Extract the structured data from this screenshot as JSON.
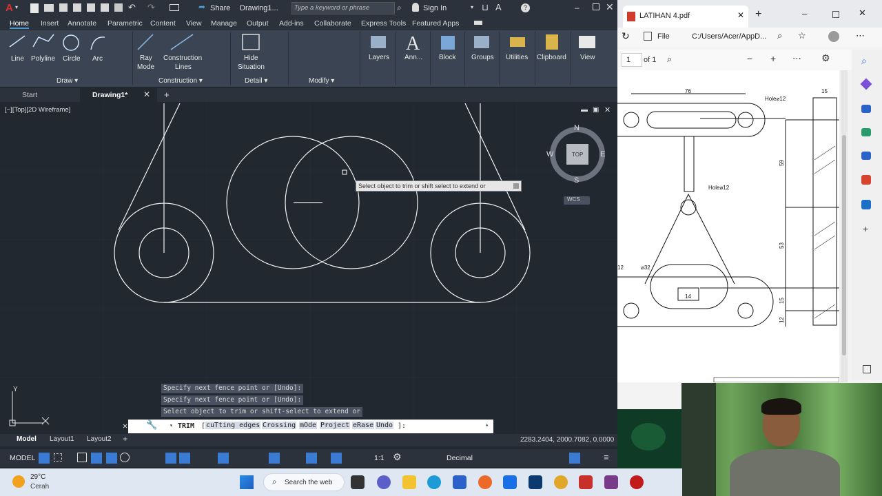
{
  "acad": {
    "app_logo": "A",
    "share_label": "Share",
    "doc_title": "Drawing1...",
    "search_placeholder": "Type a keyword or phrase",
    "signin_label": "Sign In",
    "ribbon_tabs": [
      "Home",
      "Insert",
      "Annotate",
      "Parametric",
      "Content",
      "View",
      "Manage",
      "Output",
      "Add-ins",
      "Collaborate",
      "Express Tools",
      "Featured Apps"
    ],
    "draw_tools": [
      "Line",
      "Polyline",
      "Circle",
      "Arc"
    ],
    "ray_label": "Ray\nMode",
    "ray_line1": "Ray",
    "ray_line2": "Mode",
    "construction_line1": "Construction",
    "construction_line2": "Lines",
    "hide_line1": "Hide",
    "hide_line2": "Situation",
    "big_tools": [
      "Layers",
      "Ann...",
      "Block",
      "Groups",
      "Utilities",
      "Clipboard",
      "View"
    ],
    "panel_titles": {
      "draw": "Draw ▾",
      "construction": "Construction ▾",
      "detail": "Detail ▾",
      "modify": "Modify ▾"
    },
    "doc_tabs": {
      "start": "Start",
      "drawing": "Drawing1*"
    },
    "viewport_label": "[−][Top][2D Wireframe]",
    "viewcube": {
      "n": "N",
      "s": "S",
      "e": "E",
      "w": "W",
      "top": "TOP",
      "wcs": "WCS"
    },
    "tooltip": "Select object to trim or shift select to extend or",
    "cmd_history": [
      "Specify next fence point or [Undo]:",
      "Specify next fence point or [Undo]:",
      "Select object to trim or shift-select to extend or"
    ],
    "cmd_prompt": "TRIM",
    "cmd_options": [
      "cuTting edges",
      "Crossing",
      "mOde",
      "Project",
      "eRase",
      "Undo"
    ],
    "cmd_suffix": "]:",
    "ucs_y": "Y",
    "layout_tabs": [
      "Model",
      "Layout1",
      "Layout2"
    ],
    "coords": "2283.2404, 2000.7082, 0.0000",
    "status_model": "MODEL",
    "status_scale": "1:1",
    "status_units": "Decimal"
  },
  "pdf": {
    "tab_title": "LATIHAN 4.pdf",
    "address_prefix": "File",
    "address": "C:/Users/Acer/AppD...",
    "page_num": "1",
    "page_of": "of 1",
    "dims": {
      "d76": "76",
      "d15": "15",
      "d59": "59",
      "d53": "53",
      "d15b": "15",
      "d12": "12",
      "d14": "14",
      "hole1": "Hole⌀12",
      "hole2": "Hole⌀12",
      "d32": "⌀32",
      "d12b": "12"
    }
  },
  "taskbar": {
    "temp": "29°C",
    "weather": "Cerah",
    "search_label": "Search the web"
  },
  "colors": {
    "acad_bg": "#212830",
    "ribbon": "#3b4452",
    "accent": "#3a7bd5",
    "pdf_bg": "#ffffff"
  }
}
